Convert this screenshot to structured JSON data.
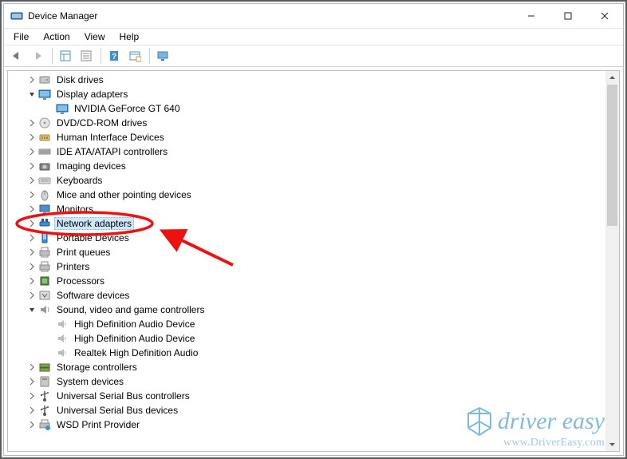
{
  "titlebar": {
    "title": "Device Manager"
  },
  "menubar": {
    "file": "File",
    "action": "Action",
    "view": "View",
    "help": "Help"
  },
  "tree": [
    {
      "depth": 1,
      "expander": "closed",
      "icon": "disk-icon",
      "label": "Disk drives",
      "name": "category-disk-drives"
    },
    {
      "depth": 1,
      "expander": "open",
      "icon": "display-icon",
      "label": "Display adapters",
      "name": "category-display-adapters"
    },
    {
      "depth": 2,
      "expander": "none",
      "icon": "display-icon",
      "label": "NVIDIA GeForce GT 640",
      "name": "device-nvidia-gt640"
    },
    {
      "depth": 1,
      "expander": "closed",
      "icon": "dvd-icon",
      "label": "DVD/CD-ROM drives",
      "name": "category-dvd"
    },
    {
      "depth": 1,
      "expander": "closed",
      "icon": "hid-icon",
      "label": "Human Interface Devices",
      "name": "category-hid"
    },
    {
      "depth": 1,
      "expander": "closed",
      "icon": "ide-icon",
      "label": "IDE ATA/ATAPI controllers",
      "name": "category-ide"
    },
    {
      "depth": 1,
      "expander": "closed",
      "icon": "imaging-icon",
      "label": "Imaging devices",
      "name": "category-imaging"
    },
    {
      "depth": 1,
      "expander": "closed",
      "icon": "keyboard-icon",
      "label": "Keyboards",
      "name": "category-keyboards"
    },
    {
      "depth": 1,
      "expander": "closed",
      "icon": "mouse-icon",
      "label": "Mice and other pointing devices",
      "name": "category-mice"
    },
    {
      "depth": 1,
      "expander": "closed",
      "icon": "monitor-icon",
      "label": "Monitors",
      "name": "category-monitors"
    },
    {
      "depth": 1,
      "expander": "closed",
      "icon": "network-icon",
      "label": "Network adapters",
      "name": "category-network-adapters",
      "selected": true
    },
    {
      "depth": 1,
      "expander": "closed",
      "icon": "portable-icon",
      "label": "Portable Devices",
      "name": "category-portable"
    },
    {
      "depth": 1,
      "expander": "closed",
      "icon": "printqueue-icon",
      "label": "Print queues",
      "name": "category-print-queues"
    },
    {
      "depth": 1,
      "expander": "closed",
      "icon": "printer-icon",
      "label": "Printers",
      "name": "category-printers"
    },
    {
      "depth": 1,
      "expander": "closed",
      "icon": "processor-icon",
      "label": "Processors",
      "name": "category-processors"
    },
    {
      "depth": 1,
      "expander": "closed",
      "icon": "software-icon",
      "label": "Software devices",
      "name": "category-software"
    },
    {
      "depth": 1,
      "expander": "open",
      "icon": "sound-icon",
      "label": "Sound, video and game controllers",
      "name": "category-sound"
    },
    {
      "depth": 2,
      "expander": "none",
      "icon": "speaker-icon",
      "label": "High Definition Audio Device",
      "name": "device-hda-1"
    },
    {
      "depth": 2,
      "expander": "none",
      "icon": "speaker-icon",
      "label": "High Definition Audio Device",
      "name": "device-hda-2"
    },
    {
      "depth": 2,
      "expander": "none",
      "icon": "speaker-icon",
      "label": "Realtek High Definition Audio",
      "name": "device-realtek"
    },
    {
      "depth": 1,
      "expander": "closed",
      "icon": "storage-icon",
      "label": "Storage controllers",
      "name": "category-storage"
    },
    {
      "depth": 1,
      "expander": "closed",
      "icon": "system-icon",
      "label": "System devices",
      "name": "category-system"
    },
    {
      "depth": 1,
      "expander": "closed",
      "icon": "usb-icon",
      "label": "Universal Serial Bus controllers",
      "name": "category-usb-controllers"
    },
    {
      "depth": 1,
      "expander": "closed",
      "icon": "usb-icon",
      "label": "Universal Serial Bus devices",
      "name": "category-usb-devices"
    },
    {
      "depth": 1,
      "expander": "closed",
      "icon": "wsd-icon",
      "label": "WSD Print Provider",
      "name": "category-wsd"
    }
  ],
  "watermark": {
    "brand": "driver easy",
    "url": "www.DriverEasy.com"
  }
}
